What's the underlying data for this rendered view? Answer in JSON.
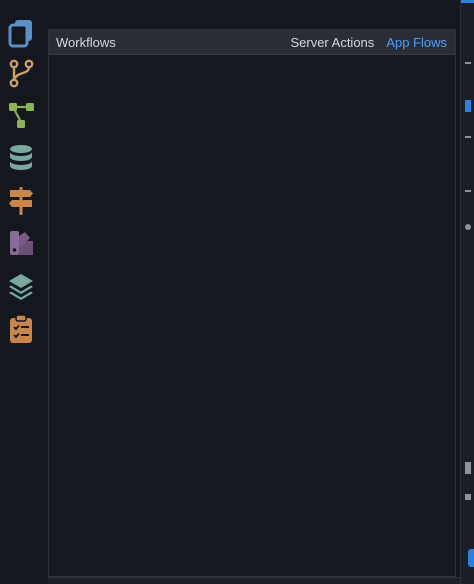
{
  "panel": {
    "title": "Workflows",
    "tabs": [
      {
        "label": "Server Actions",
        "active": false
      },
      {
        "label": "App Flows",
        "active": true
      }
    ]
  },
  "rail": {
    "items": [
      {
        "icon": "document-icon",
        "color": "#5b8fc7"
      },
      {
        "icon": "branch-icon",
        "color": "#c9a06a"
      },
      {
        "icon": "tree-flow-icon",
        "color": "#8cb35a"
      },
      {
        "icon": "database-icon",
        "color": "#7aa89f"
      },
      {
        "icon": "signpost-icon",
        "color": "#c8864a"
      },
      {
        "icon": "palette-icon",
        "color": "#8a6a96"
      },
      {
        "icon": "layers-icon",
        "color": "#7aa89f"
      },
      {
        "icon": "clipboard-checklist-icon",
        "color": "#c8864a"
      }
    ]
  },
  "colors": {
    "accent": "#4a9eff",
    "background": "#15171e",
    "header": "#2a2d36"
  }
}
